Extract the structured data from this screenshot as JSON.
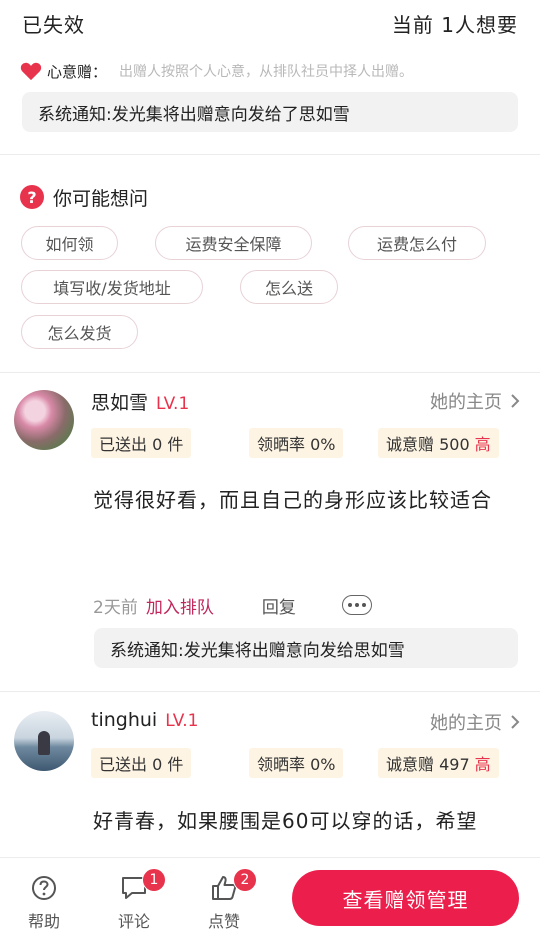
{
  "header": {
    "status": "已失效",
    "want_count": "当前 1人想要"
  },
  "gift_rule": {
    "icon": "heart-icon",
    "label": "心意赠：",
    "description": "出赠人按照个人心意，从排队社员中择人出赠。"
  },
  "system_notice_top": "系统通知:发光集将出赠意向发给了思如雪",
  "faq": {
    "title": "你可能想问",
    "icon": "question-icon",
    "chips": [
      "如何领",
      "运费安全保障",
      "运费怎么付",
      "填写收/发货地址",
      "怎么送",
      "怎么发货"
    ]
  },
  "comments": [
    {
      "username": "思如雪",
      "level": "LV.1",
      "home_link": "她的主页",
      "sent": "已送出 0 件",
      "review_rate": "领晒率 0%",
      "sincerity": "诚意赠 500",
      "sincerity_level": "高",
      "text": "觉得很好看，而且自己的身形应该比较适合",
      "time": "2天前",
      "queue_action": "加入排队",
      "reply": "回复",
      "system_notice": "系统通知:发光集将出赠意向发给思如雪"
    },
    {
      "username": "tinghui",
      "level": "LV.1",
      "home_link": "她的主页",
      "sent": "已送出 0 件",
      "review_rate": "领晒率 0%",
      "sincerity": "诚意赠 497",
      "sincerity_level": "高",
      "text": "好青春，如果腰围是60可以穿的话，希望"
    }
  ],
  "bottom_bar": {
    "help": "帮助",
    "comment": "评论",
    "comment_badge": "1",
    "like": "点赞",
    "like_badge": "2",
    "cta": "查看赠领管理"
  },
  "colors": {
    "accent": "#ec1f4c",
    "level": "#e8334d",
    "tag_bg": "#fdf4e4",
    "notice_bg": "#f2f2f2"
  }
}
